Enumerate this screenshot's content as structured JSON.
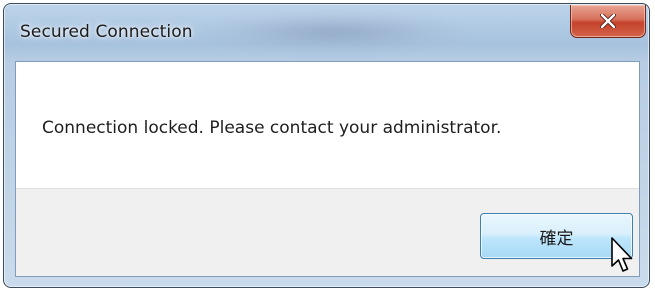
{
  "dialog": {
    "title": "Secured Connection",
    "message": "Connection locked. Please contact your administrator.",
    "ok_label": "確定",
    "close_icon": "close-x-icon"
  },
  "colors": {
    "title_bar": "#a7c2de",
    "close_button": "#c4422c",
    "ok_button": "#bee6fd",
    "footer": "#f0f0f0"
  }
}
